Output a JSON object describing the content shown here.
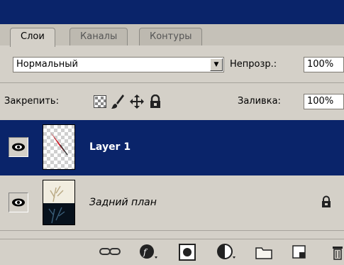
{
  "panel": {
    "tabs": [
      {
        "label": "Слои",
        "active": true
      },
      {
        "label": "Каналы",
        "active": false
      },
      {
        "label": "Контуры",
        "active": false
      }
    ]
  },
  "controls": {
    "blend_mode": "Нормальный",
    "opacity_label": "Непрозр.:",
    "opacity_value": "100%",
    "lock_label": "Закрепить:",
    "fill_label": "Заливка:",
    "fill_value": "100%"
  },
  "layers": [
    {
      "name": "Layer 1",
      "selected": true,
      "visible": true
    },
    {
      "name": "Задний план",
      "selected": false,
      "visible": true,
      "locked": true,
      "italic": true
    }
  ],
  "bottom_icons": [
    "link-icon",
    "layer-style-icon",
    "mask-icon",
    "adjustment-icon",
    "group-icon",
    "new-layer-icon",
    "trash-icon"
  ],
  "colors": {
    "selection": "#0a246a",
    "panel": "#d4d0c8"
  }
}
